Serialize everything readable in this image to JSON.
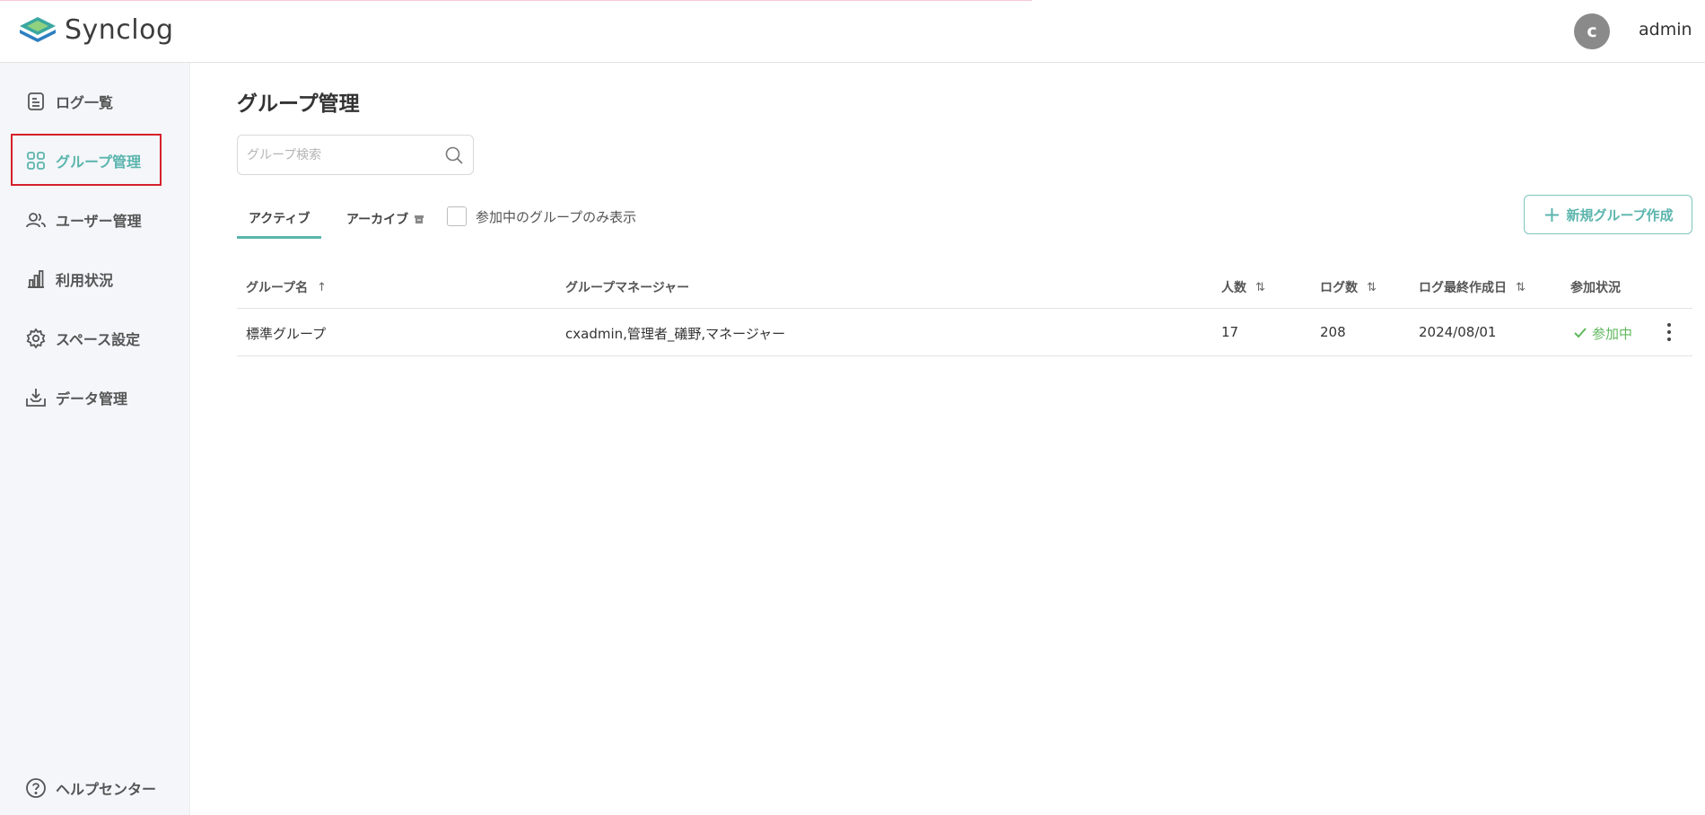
{
  "app": {
    "name": "Synclog",
    "brand_color": "#5bb5ad"
  },
  "header": {
    "avatar_initial": "c",
    "username": "admin"
  },
  "sidebar": {
    "items": [
      {
        "label": "ログ一覧",
        "icon": "document-icon"
      },
      {
        "label": "グループ管理",
        "icon": "grid-icon",
        "active": true
      },
      {
        "label": "ユーザー管理",
        "icon": "users-icon"
      },
      {
        "label": "利用状況",
        "icon": "bar-chart-icon"
      },
      {
        "label": "スペース設定",
        "icon": "gear-icon"
      },
      {
        "label": "データ管理",
        "icon": "download-tray-icon"
      }
    ],
    "help": {
      "label": "ヘルプセンター",
      "icon": "question-circle-icon"
    }
  },
  "main": {
    "title": "グループ管理",
    "search": {
      "placeholder": "グループ検索",
      "value": ""
    },
    "tabs": [
      {
        "label": "アクティブ",
        "active": true
      },
      {
        "label": "アーカイブ",
        "icon": "archive-icon"
      }
    ],
    "filter_checkbox": {
      "label": "参加中のグループのみ表示",
      "checked": false
    },
    "new_button": {
      "label": "新規グループ作成",
      "icon": "plus-icon"
    },
    "table": {
      "columns": [
        {
          "label": "グループ名",
          "sort": "↑"
        },
        {
          "label": "グループマネージャー",
          "sort": ""
        },
        {
          "label": "人数",
          "sort": "⇅"
        },
        {
          "label": "ログ数",
          "sort": "⇅"
        },
        {
          "label": "ログ最終作成日",
          "sort": "⇅"
        },
        {
          "label": "参加状況",
          "sort": ""
        }
      ],
      "rows": [
        {
          "name": "標準グループ",
          "managers": "cxadmin,管理者_礒野,マネージャー",
          "members": "17",
          "logs": "208",
          "last_created": "2024/08/01",
          "status": "参加中",
          "status_color": "#5fb85d"
        }
      ]
    }
  }
}
